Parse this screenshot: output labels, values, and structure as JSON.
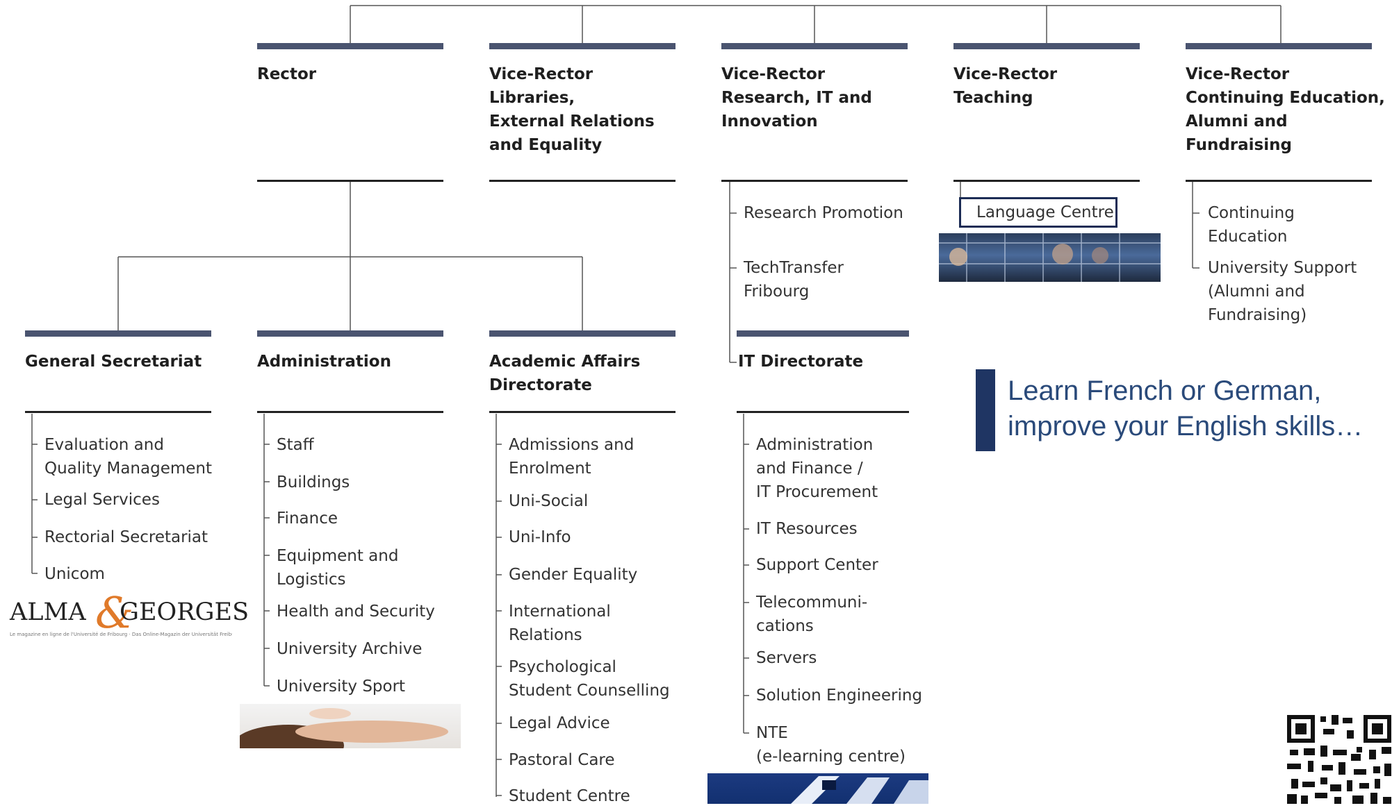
{
  "top_row": [
    {
      "title": "Rector",
      "items": []
    },
    {
      "title": "Vice-Rector\nLibraries,\nExternal Relations\nand Equality",
      "items": []
    },
    {
      "title": "Vice-Rector\nResearch, IT and\nInnovation",
      "items": [
        "Research Promotion",
        "TechTransfer\nFribourg"
      ]
    },
    {
      "title": "Vice-Rector\nTeaching",
      "items": [
        "Language Centre"
      ]
    },
    {
      "title": "Vice-Rector\nContinuing Education,\nAlumni and\nFundraising",
      "items": [
        "Continuing\nEducation",
        "University Support\n(Alumni and\nFundraising)"
      ]
    }
  ],
  "bottom_row": [
    {
      "title": "General Secretariat",
      "items": [
        "Evaluation and\nQuality Management",
        "Legal Services",
        "Rectorial Secretariat",
        "Unicom"
      ]
    },
    {
      "title": "Administration",
      "items": [
        "Staff",
        "Buildings",
        "Finance",
        "Equipment and\nLogistics",
        "Health and Security",
        "University Archive",
        "University Sport"
      ]
    },
    {
      "title": "Academic Affairs\nDirectorate",
      "items": [
        "Admissions and\nEnrolment",
        "Uni-Social",
        "Uni-Info",
        "Gender Equality",
        "International\nRelations",
        "Psychological\nStudent Counselling",
        "Legal Advice",
        "Pastoral Care",
        "Student Centre"
      ]
    },
    {
      "title": "IT Directorate",
      "items": [
        "Administration\nand Finance /\nIT Procurement",
        "IT Resources",
        "Support Center",
        "Telecommuni-\ncations",
        "Servers",
        "Solution Engineering",
        "NTE\n(e-learning centre)"
      ]
    }
  ],
  "tagline": "Learn French or German,\nimprove your English skills…",
  "logo": {
    "word_left": "ALMA",
    "ampersand": "&",
    "word_right": "GEORGES",
    "subtitle": "Le magazine en ligne de l'Université de Fribourg · Das Online-Magazin der Universität Freiburg"
  },
  "colors": {
    "bar": "#4a5470",
    "accent": "#1f3563",
    "tagline": "#2a4a7a",
    "logo_amp": "#e07a2a"
  }
}
